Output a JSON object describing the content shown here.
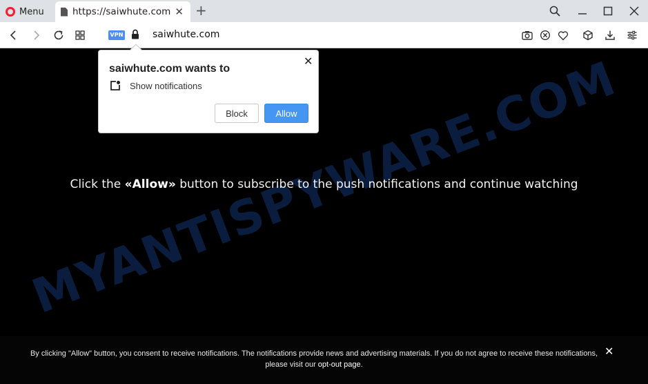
{
  "browser": {
    "menu_label": "Menu",
    "tab_title": "https://saiwhute.com",
    "url": "saiwhute.com",
    "vpn_label": "VPN"
  },
  "page": {
    "message_prefix": "Click the ",
    "message_allow": "«Allow»",
    "message_suffix": " button to subscribe to the push notifications and continue watching",
    "watermark": "MYANTISPYWARE.COM",
    "consent_text": "By clicking \"Allow\" button, you consent to receive notifications. The notifications provide news and advertising materials. If you do not agree to receive these notifications, please visit our ",
    "consent_link": "opt-out page",
    "consent_end": "."
  },
  "popup": {
    "title": "saiwhute.com wants to",
    "permission": "Show notifications",
    "block_label": "Block",
    "allow_label": "Allow"
  },
  "colors": {
    "allow_button": "#4596f3",
    "vpn_badge": "#4c8ef0",
    "opera_red": "#ff1b2d",
    "watermark": "#0b1d3e"
  },
  "icons": {
    "menu": "opera-logo-icon",
    "tab": "page-icon",
    "close": "close-icon",
    "new_tab": "plus-icon",
    "search": "search-icon",
    "minimize": "minimize-icon",
    "maximize": "maximize-icon",
    "back": "back-arrow-icon",
    "forward": "forward-arrow-icon",
    "reload": "reload-icon",
    "tabs_grid": "grid-icon",
    "lock": "lock-icon",
    "camera": "camera-icon",
    "adblock": "adblock-icon",
    "heart": "heart-icon",
    "cube": "cube-icon",
    "download": "download-icon",
    "settings": "settings-icon",
    "notification": "notification-bell-icon"
  }
}
